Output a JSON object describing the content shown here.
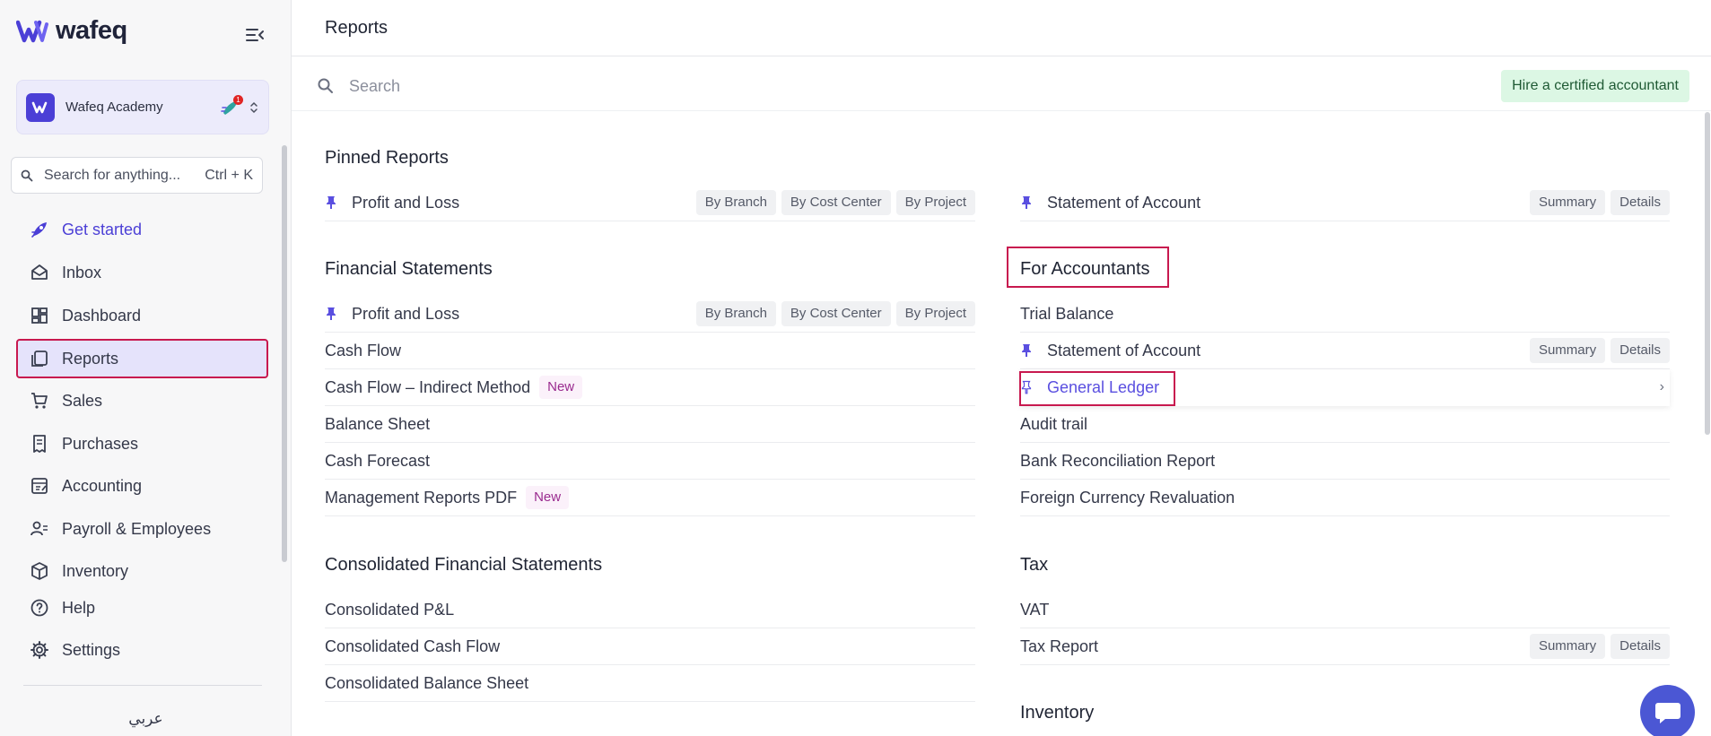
{
  "brand": {
    "name": "wafeq"
  },
  "org": {
    "name": "Wafeq Academy",
    "badge": "1"
  },
  "sidebar_search": {
    "placeholder": "Search for anything...",
    "shortcut": "Ctrl + K"
  },
  "nav": [
    {
      "label": "Get started",
      "icon": "rocket-icon"
    },
    {
      "label": "Inbox",
      "icon": "envelope-icon"
    },
    {
      "label": "Dashboard",
      "icon": "dashboard-icon"
    },
    {
      "label": "Reports",
      "icon": "reports-icon"
    },
    {
      "label": "Sales",
      "icon": "cart-icon"
    },
    {
      "label": "Purchases",
      "icon": "receipt-icon"
    },
    {
      "label": "Accounting",
      "icon": "ledger-icon"
    },
    {
      "label": "Payroll & Employees",
      "icon": "people-icon"
    },
    {
      "label": "Inventory",
      "icon": "box-icon"
    },
    {
      "label": "Help",
      "icon": "help-icon"
    },
    {
      "label": "Settings",
      "icon": "gear-icon"
    }
  ],
  "language_toggle": "عربي",
  "page": {
    "title": "Reports"
  },
  "main_search": {
    "placeholder": "Search"
  },
  "hire_button": "Hire a certified accountant",
  "tags": {
    "by_branch": "By Branch",
    "by_cost_center": "By Cost Center",
    "by_project": "By Project",
    "summary": "Summary",
    "details": "Details",
    "new": "New"
  },
  "sections": {
    "pinned": {
      "title": "Pinned Reports",
      "left": {
        "name": "Profit and Loss"
      },
      "right": {
        "name": "Statement of Account"
      }
    },
    "financial": {
      "title": "Financial Statements",
      "rows": [
        "Profit and Loss",
        "Cash Flow",
        "Cash Flow – Indirect Method",
        "Balance Sheet",
        "Cash Forecast",
        "Management Reports PDF"
      ]
    },
    "consolidated": {
      "title": "Consolidated Financial Statements",
      "rows": [
        "Consolidated P&L",
        "Consolidated Cash Flow",
        "Consolidated Balance Sheet"
      ]
    },
    "accountants": {
      "title": "For Accountants",
      "rows": [
        "Trial Balance",
        "Statement of Account",
        "General Ledger",
        "Audit trail",
        "Bank Reconciliation Report",
        "Foreign Currency Revaluation"
      ]
    },
    "tax": {
      "title": "Tax",
      "rows": [
        "VAT",
        "Tax Report"
      ]
    },
    "inventory": {
      "title": "Inventory"
    }
  }
}
